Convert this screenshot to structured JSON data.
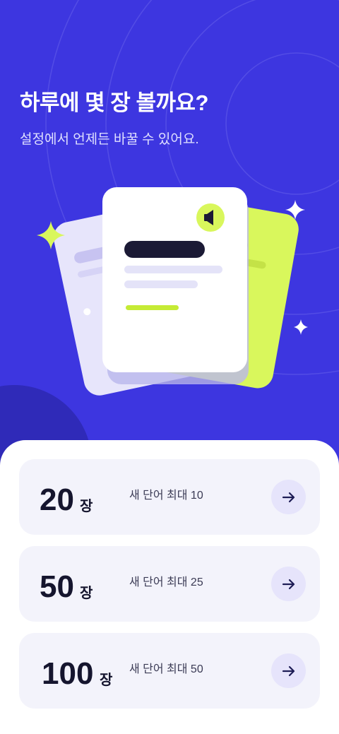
{
  "header": {
    "title": "하루에 몇 장 볼까요?",
    "subtitle": "설정에서 언제든 바꿀 수 있어요."
  },
  "illustration": {
    "icons": [
      "speaker-icon",
      "sparkle-icon"
    ],
    "colors": {
      "accent": "#d9f75c",
      "background": "#3d36e0",
      "card": "#ffffff",
      "card_back": "#e7e5fb"
    }
  },
  "options": [
    {
      "count": "20",
      "unit": "장",
      "description": "새 단어 최대 10",
      "icon": "arrow-right-icon"
    },
    {
      "count": "50",
      "unit": "장",
      "description": "새 단어 최대 25",
      "icon": "arrow-right-icon"
    },
    {
      "count": "100",
      "unit": "장",
      "description": "새 단어 최대 50",
      "icon": "arrow-right-icon"
    }
  ]
}
